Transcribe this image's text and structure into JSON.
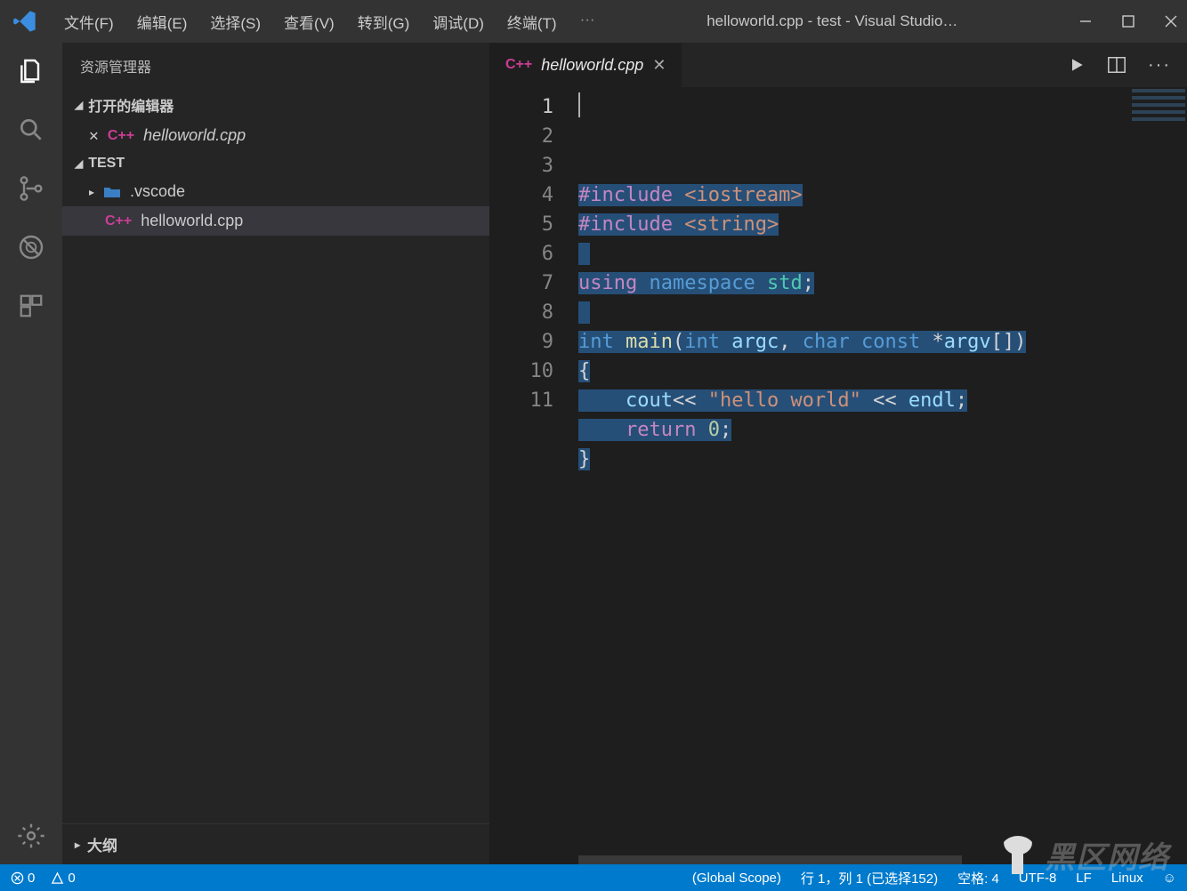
{
  "titlebar": {
    "menus": [
      "文件(F)",
      "编辑(E)",
      "选择(S)",
      "查看(V)",
      "转到(G)",
      "调试(D)",
      "终端(T)"
    ],
    "ellipsis": "···",
    "title": "helloworld.cpp - test - Visual Studio…"
  },
  "sidebar": {
    "title": "资源管理器",
    "open_editors_label": "打开的编辑器",
    "open_editors": [
      {
        "name": "helloworld.cpp",
        "dirty": true,
        "lang": "C++"
      }
    ],
    "workspace_name": "TEST",
    "folders": [
      {
        "name": ".vscode",
        "icon": "folder"
      }
    ],
    "files": [
      {
        "name": "helloworld.cpp",
        "lang": "C++"
      }
    ],
    "outline_label": "大纲"
  },
  "tabs": {
    "items": [
      {
        "name": "helloworld.cpp",
        "lang": "C++"
      }
    ]
  },
  "code": {
    "lines": [
      {
        "n": "1",
        "html": "<span class='sel'><span class='k-include'>#include</span> <span class='k-string'>&lt;iostream&gt;</span></span>"
      },
      {
        "n": "2",
        "html": "<span class='sel'><span class='k-include'>#include</span> <span class='k-string'>&lt;string&gt;</span></span>"
      },
      {
        "n": "3",
        "html": "<span class='sel'> </span>"
      },
      {
        "n": "4",
        "html": "<span class='sel'><span class='k-keyword'>using</span> <span class='k-storage'>namespace</span> <span class='k-class'>std</span><span class='k-plain'>;</span></span>"
      },
      {
        "n": "5",
        "html": "<span class='sel'> </span>"
      },
      {
        "n": "6",
        "html": "<span class='sel'><span class='k-storage'>int</span> <span class='k-func'>main</span><span class='k-plain'>(</span><span class='k-storage'>int</span> <span class='k-ident'>argc</span><span class='k-plain'>,</span> <span class='k-storage'>char</span> <span class='k-storage'>const</span> <span class='k-plain'>*</span><span class='k-ident'>argv</span><span class='k-plain'>[])</span></span>"
      },
      {
        "n": "7",
        "html": "<span class='sel'><span class='k-plain'>{</span></span>"
      },
      {
        "n": "8",
        "html": "<span class='sel'>    <span class='k-ident'>cout</span><span class='k-plain'>&lt;&lt;</span> <span class='k-string'>\"hello world\"</span> <span class='k-plain'>&lt;&lt;</span> <span class='k-ident'>endl</span><span class='k-plain'>;</span></span>"
      },
      {
        "n": "9",
        "html": "<span class='sel'>    <span class='k-keyword'>return</span> <span class='k-num'>0</span><span class='k-plain'>;</span></span>"
      },
      {
        "n": "10",
        "html": "<span class='sel'><span class='k-plain'>}</span></span>"
      },
      {
        "n": "11",
        "html": ""
      }
    ]
  },
  "statusbar": {
    "errors": "0",
    "warnings": "0",
    "scope": "(Global Scope)",
    "cursor": "行 1，列 1 (已选择152)",
    "spaces": "空格: 4",
    "encoding": "UTF-8",
    "eol": "LF",
    "lang": "Linux",
    "feedback": "☺"
  },
  "watermark": "黑区网络"
}
